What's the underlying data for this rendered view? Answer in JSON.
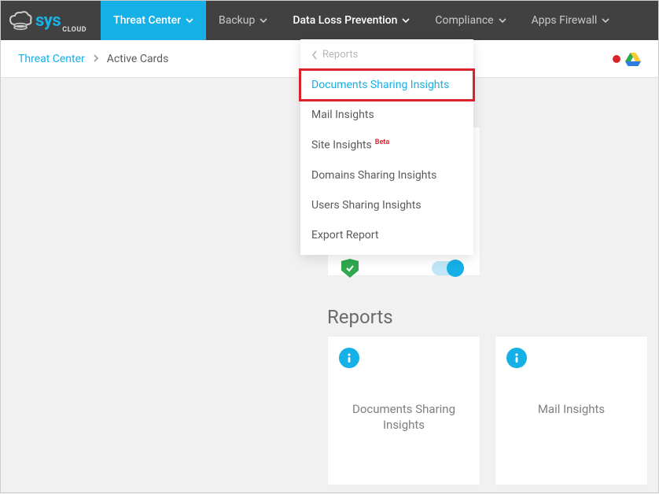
{
  "logo": {
    "brand_main": "sys",
    "brand_sub": "CLOUD"
  },
  "nav": {
    "threat_center": "Threat Center",
    "backup": "Backup",
    "dlp": "Data Loss Prevention",
    "compliance": "Compliance",
    "apps_firewall": "Apps Firewall"
  },
  "breadcrumb": {
    "root": "Threat Center",
    "current": "Active Cards"
  },
  "dropdown": {
    "header": "Reports",
    "items": [
      {
        "label": "Documents Sharing Insights",
        "active": true
      },
      {
        "label": "Mail Insights"
      },
      {
        "label": "Site Insights",
        "beta": "Beta"
      },
      {
        "label": "Domains Sharing Insights"
      },
      {
        "label": "Users Sharing Insights"
      },
      {
        "label": "Export Report"
      }
    ]
  },
  "reports": {
    "heading": "Reports",
    "cards": [
      {
        "title": "Documents Sharing Insights"
      },
      {
        "title": "Mail Insights"
      }
    ]
  }
}
